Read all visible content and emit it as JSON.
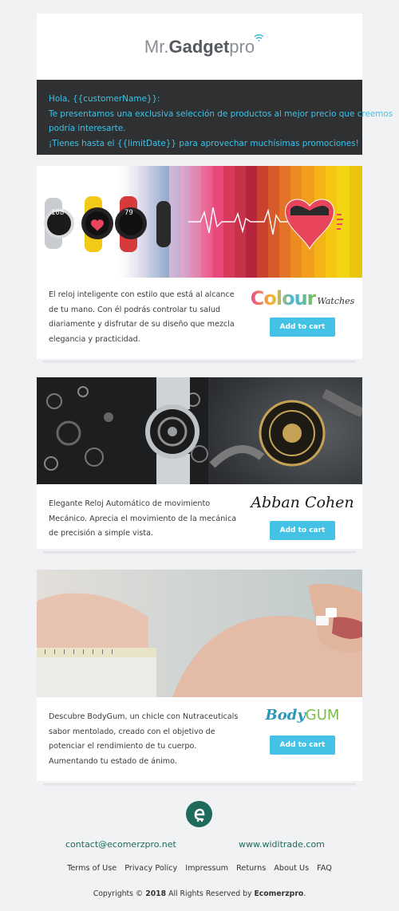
{
  "header": {
    "logo_prefix": "Mr.",
    "logo_bold": "Gadget",
    "logo_suffix": "pro"
  },
  "greeting": {
    "line1": "Hola, {{customerName}}:",
    "line2": "Te presentamos una exclusiva selección de productos al mejor precio que creemos",
    "line3": "podría interesarte.",
    "line4": "¡Tienes hasta el {{limitDate}} para aprovechar muchísimas promociones!"
  },
  "products": [
    {
      "brand_main": "Colour",
      "brand_sub": "Watches",
      "description": [
        "El reloj inteligente con estilo que está al alcance",
        "de tu mano. Con él podrás controlar tu salud",
        "diariamente y disfrutar de su diseño que mezcla",
        "elegancia y practicidad."
      ],
      "button_label": "Add to cart",
      "watch_faces": [
        "108",
        "79"
      ]
    },
    {
      "brand_main": "Abban Cohen",
      "description": [
        "Elegante Reloj Automático de movimiento",
        "Mecánico. Aprecia el movimiento de la mecánica",
        "de precisión a simple vista."
      ],
      "button_label": "Add to cart"
    },
    {
      "brand_main": "Body",
      "brand_sub": "GUM",
      "description": [
        "Descubre BodyGum, un chicle con Nutraceuticals",
        "sabor mentolado, creado con el objetivo de",
        "potenciar el rendimiento de tu cuerpo.",
        "Aumentando tu estado de ánimo."
      ],
      "button_label": "Add to cart"
    }
  ],
  "footer": {
    "email": "contact@ecomerzpro.net",
    "website": "www.widitrade.com",
    "links": [
      "Terms of Use",
      "Privacy Policy",
      "Impressum",
      "Returns",
      "About Us",
      "FAQ"
    ],
    "copyright_prefix": "Copyrights ©",
    "copyright_year": "2018",
    "copyright_mid": "All Rights Reserved by",
    "copyright_brand": "Ecomerzpro",
    "copyright_end": "."
  },
  "colors": {
    "accent": "#44c2e6",
    "greeting_bg": "#2e3032",
    "greeting_text": "#3ec3ea",
    "footer_green": "#1e6a5c"
  }
}
